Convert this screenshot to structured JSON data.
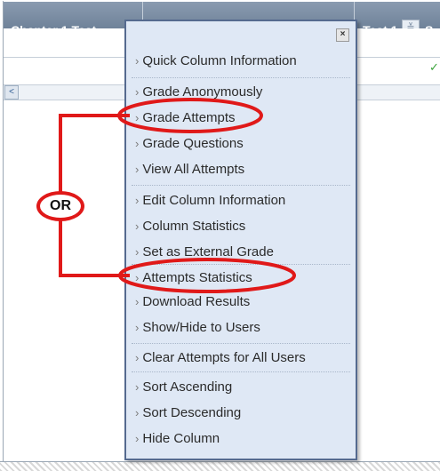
{
  "grid": {
    "column_title": "Chapter 1 Test",
    "column_title_right": "Test 1",
    "column_title_clipped": "S",
    "header_chevron": "≚",
    "checkmark": "✓",
    "scroll_left_arrow": "<"
  },
  "menu": {
    "close_label": "×",
    "chevron": "›",
    "items": [
      "Quick Column Information",
      "Grade Anonymously",
      "Grade Attempts",
      "Grade Questions",
      "View All Attempts",
      "Edit Column Information",
      "Column Statistics",
      "Set as External Grade",
      "Attempts Statistics",
      "Download Results",
      "Show/Hide to Users",
      "Clear Attempts for All Users",
      "Sort Ascending",
      "Sort Descending",
      "Hide Column"
    ]
  },
  "annotation": {
    "label": "OR",
    "color": "#e01919"
  },
  "colors": {
    "header_bg": "#7a8ca3",
    "menu_bg": "#dfe8f5",
    "menu_border": "#556a8f"
  }
}
